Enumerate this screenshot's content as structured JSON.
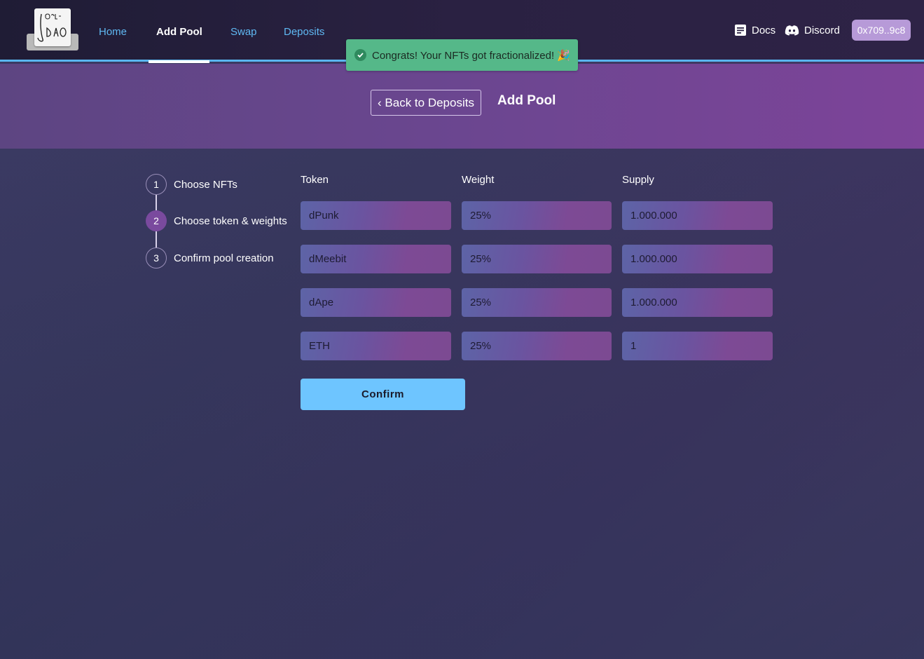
{
  "nav": {
    "logo_text": "Deal DAO",
    "items": [
      {
        "label": "Home"
      },
      {
        "label": "Add Pool"
      },
      {
        "label": "Swap"
      },
      {
        "label": "Deposits"
      }
    ],
    "docs_label": "Docs",
    "discord_label": "Discord",
    "wallet": "0x709..9c8"
  },
  "toast": {
    "message": "Congrats! Your NFTs got fractionalized! 🎉"
  },
  "header": {
    "back_label": "‹ Back to Deposits",
    "title": "Add Pool"
  },
  "steps": [
    {
      "num": "1",
      "label": "Choose NFTs"
    },
    {
      "num": "2",
      "label": "Choose token & weights"
    },
    {
      "num": "3",
      "label": "Confirm pool creation"
    }
  ],
  "table": {
    "headers": {
      "token": "Token",
      "weight": "Weight",
      "supply": "Supply"
    },
    "rows": [
      {
        "token": "dPunk",
        "weight": "25%",
        "supply": "1.000.000"
      },
      {
        "token": "dMeebit",
        "weight": "25%",
        "supply": "1.000.000"
      },
      {
        "token": "dApe",
        "weight": "25%",
        "supply": "1.000.000"
      },
      {
        "token": "ETH",
        "weight": "25%",
        "supply": "1"
      }
    ]
  },
  "confirm_label": "Confirm",
  "colors": {
    "accent": "#6ec5ff",
    "toast": "#55b889",
    "wallet": "#b79ad8",
    "step_active": "#7a4a9e"
  }
}
